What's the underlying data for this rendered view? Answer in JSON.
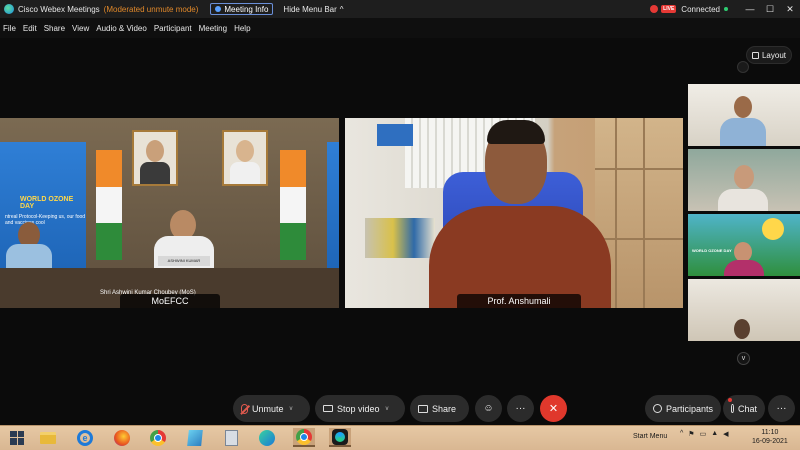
{
  "titlebar": {
    "app_title": "Cisco Webex Meetings",
    "mode": "(Moderated unmute mode)",
    "meeting_info": "Meeting Info",
    "hide_menu_bar": "Hide Menu Bar",
    "live_badge": "LIVE",
    "status": "Connected",
    "window_controls": [
      "—",
      "☐",
      "✕"
    ]
  },
  "menu": [
    "File",
    "Edit",
    "Share",
    "View",
    "Audio & Video",
    "Participant",
    "Meeting",
    "Help"
  ],
  "layout_button": "Layout",
  "main_videos": [
    {
      "label": "MoEFCC",
      "banner_title": "WORLD OZONE DAY",
      "banner_subtitle": "ntreal Protocol-Keeping us, our food and vaccines cool",
      "nameplate": "ASHWINI KUMAR CHOUBEY",
      "caption": "Shri Ashwini Kumar Choubey (MoS)"
    },
    {
      "label": "Prof. Anshumali"
    }
  ],
  "thumbnails": [
    {
      "name": "participant-1"
    },
    {
      "name": "participant-2"
    },
    {
      "name": "participant-3",
      "overlay_text": "WORLD OZONE DAY"
    },
    {
      "name": "participant-4"
    }
  ],
  "controls": {
    "unmute": "Unmute",
    "stop_video": "Stop video",
    "share": "Share",
    "more": "···",
    "end": "✕",
    "participants": "Participants",
    "chat": "Chat",
    "chat_more": "···"
  },
  "taskbar": {
    "start_menu": "Start Menu",
    "time": "11:10",
    "date": "16-09-2021"
  },
  "colors": {
    "end_red": "#e0382c",
    "muted_red": "#e25a4e",
    "connected_green": "#2ecc71",
    "mode_orange": "#e0882a",
    "taskbar": "#ddbb96"
  }
}
